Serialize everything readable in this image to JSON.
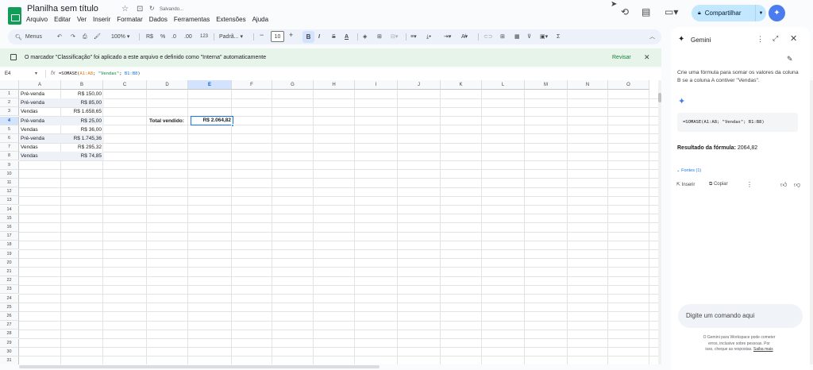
{
  "app": {
    "doc_title": "Planilha sem título",
    "saving_status": "Salvando...",
    "menu": [
      "Arquivo",
      "Editar",
      "Ver",
      "Inserir",
      "Formatar",
      "Dados",
      "Ferramentas",
      "Extensões",
      "Ajuda"
    ],
    "share_label": "Compartilhar"
  },
  "toolbar": {
    "search_label": "Menus",
    "zoom": "100%",
    "currency": "R$",
    "percent": "%",
    "decrease_decimals": ".0",
    "increase_decimals": ".00",
    "number_format": "123",
    "font": "Padrã...",
    "font_size": "10"
  },
  "banner": {
    "message": "O marcador \"Classificação\" foi aplicado a este arquivo e definido como \"Interna\" automaticamente",
    "review": "Revisar"
  },
  "formula_bar": {
    "cell_ref": "E4",
    "fx": "fx",
    "f1": "=SOMASE(",
    "f2": "A1:A8",
    "f3": "; ",
    "f4": "\"Vendas\"",
    "f5": "; ",
    "f6": "B1:B8",
    "f7": ")"
  },
  "sheet": {
    "columns": [
      "A",
      "B",
      "C",
      "D",
      "E",
      "F",
      "G",
      "H",
      "I",
      "J",
      "K",
      "L",
      "M",
      "N",
      "O"
    ],
    "rows": [
      {
        "a": "Pré-venda",
        "b": "R$ 150,00"
      },
      {
        "a": "Pré-venda",
        "b": "R$ 85,00"
      },
      {
        "a": "Vendas",
        "b": "R$ 1.658,65"
      },
      {
        "a": "Pré-venda",
        "b": "R$ 25,00"
      },
      {
        "a": "Vendas",
        "b": "R$ 36,00"
      },
      {
        "a": "Pré-venda",
        "b": "R$ 1.745,36"
      },
      {
        "a": "Vendas",
        "b": "R$ 295,32"
      },
      {
        "a": "Vendas",
        "b": "R$ 74,85"
      }
    ],
    "row_count": 31,
    "total_label": "Total vendido:",
    "total_value": "R$ 2.064,82"
  },
  "gemini": {
    "title": "Gemini",
    "prompt": "Crie uma fórmula para somar os valores da coluna B se a coluna A contiver \"Vendas\".",
    "formula": "=SOMASE(A1:A8; \"Vendas\"; B1:B8)",
    "result_label": "Resultado da fórmula:",
    "result_value": "2064,82",
    "sources": "Fontes (1)",
    "insert": "Inserir",
    "copy": "Copiar",
    "input_placeholder": "Digite um comando aqui",
    "footer1": "O Gemini para Workspace pode cometer",
    "footer2": "erros, inclusive sobre pessoas. Por",
    "footer3": "isso, cheque as respostas.",
    "footer_link": "Saiba mais"
  },
  "colors": {
    "accent": "#1a73e8",
    "share_bg": "#c2e7ff",
    "banner_bg": "#e6f4ea",
    "sheets_green": "#0f9d58"
  }
}
